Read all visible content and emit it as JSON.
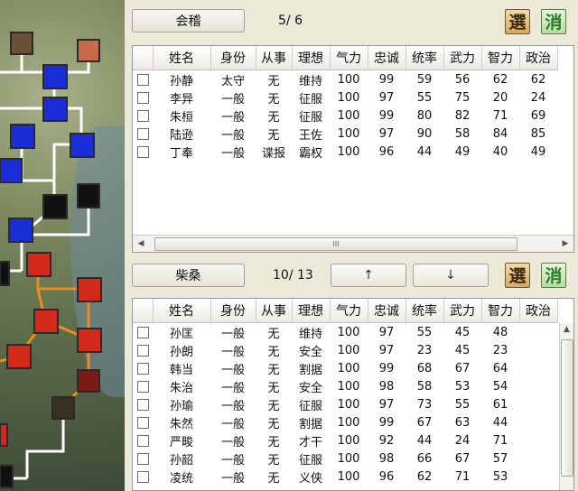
{
  "city1": {
    "name": "会稽",
    "count": "5/  6",
    "select_label": "選",
    "cancel_label": "消"
  },
  "city2": {
    "name": "柴桑",
    "count": "10/ 13",
    "up_label": "↑",
    "down_label": "↓",
    "select_label": "選",
    "cancel_label": "消"
  },
  "columns": [
    "姓名",
    "身份",
    "从事",
    "理想",
    "气力",
    "忠诚",
    "统率",
    "武力",
    "智力",
    "政治"
  ],
  "list1_rows": [
    [
      "孙静",
      "太守",
      "无",
      "维持",
      "100",
      "99",
      "59",
      "56",
      "62",
      "62"
    ],
    [
      "李异",
      "一般",
      "无",
      "征服",
      "100",
      "97",
      "55",
      "75",
      "20",
      "24"
    ],
    [
      "朱桓",
      "一般",
      "无",
      "征服",
      "100",
      "99",
      "80",
      "82",
      "71",
      "69"
    ],
    [
      "陆逊",
      "一般",
      "无",
      "王佐",
      "100",
      "97",
      "90",
      "58",
      "84",
      "85"
    ],
    [
      "丁奉",
      "一般",
      "谍报",
      "霸权",
      "100",
      "96",
      "44",
      "49",
      "40",
      "49"
    ]
  ],
  "list2_rows": [
    [
      "孙匡",
      "一般",
      "无",
      "维持",
      "100",
      "97",
      "55",
      "45",
      "48"
    ],
    [
      "孙朗",
      "一般",
      "无",
      "安全",
      "100",
      "97",
      "23",
      "45",
      "23"
    ],
    [
      "韩当",
      "一般",
      "无",
      "割据",
      "100",
      "99",
      "68",
      "67",
      "64"
    ],
    [
      "朱治",
      "一般",
      "无",
      "安全",
      "100",
      "98",
      "58",
      "53",
      "54"
    ],
    [
      "孙瑜",
      "一般",
      "无",
      "征服",
      "100",
      "97",
      "73",
      "55",
      "61"
    ],
    [
      "朱然",
      "一般",
      "无",
      "割据",
      "100",
      "99",
      "67",
      "63",
      "44"
    ],
    [
      "严畯",
      "一般",
      "无",
      "才干",
      "100",
      "92",
      "44",
      "24",
      "71"
    ],
    [
      "孙韶",
      "一般",
      "无",
      "征服",
      "100",
      "98",
      "66",
      "67",
      "57"
    ],
    [
      "凌统",
      "一般",
      "无",
      "义侠",
      "100",
      "96",
      "62",
      "71",
      "53"
    ]
  ],
  "hscroll_grip": "III",
  "colors": {
    "red_city": "#d42a1c",
    "blue_city": "#1a2ed8",
    "brown_city": "#c86a4a",
    "road_white": "#ffffff",
    "road_orange": "#f08a1a"
  }
}
